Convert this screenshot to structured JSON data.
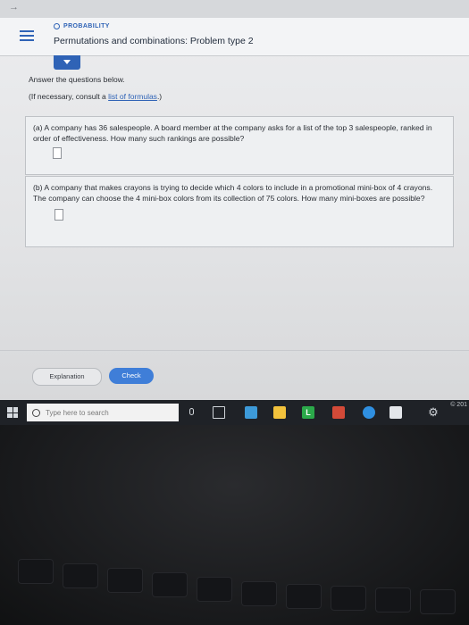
{
  "header": {
    "topic": "PROBABILITY",
    "title": "Permutations and combinations: Problem type 2"
  },
  "instructions": {
    "text": "Answer the questions below.",
    "consult_prefix": "(If necessary, consult a ",
    "consult_link": "list of formulas",
    "consult_suffix": ".)"
  },
  "questions": [
    {
      "text": "(a) A company has 36 salespeople. A board member at the company asks for a list of the top 3 salespeople, ranked in order of effectiveness. How many such rankings are possible?",
      "answer": ""
    },
    {
      "text": "(b) A company that makes crayons is trying to decide which 4 colors to include in a promotional mini-box of 4 crayons. The company can choose the 4 mini-box colors from its collection of 75 colors. How many mini-boxes are possible?",
      "answer": ""
    }
  ],
  "buttons": {
    "explanation": "Explanation",
    "check": "Check"
  },
  "taskbar": {
    "search_placeholder": "Type here to search",
    "lync_letter": "L",
    "tray_text": "© 201"
  },
  "icons": {
    "menu": "hamburger-icon",
    "tab": "chevron-down-icon",
    "search": "search-icon",
    "mic": "microphone-icon",
    "settings": "gear-icon"
  },
  "colors": {
    "accent": "#2f63b6",
    "check_button": "#3f7ed8"
  }
}
